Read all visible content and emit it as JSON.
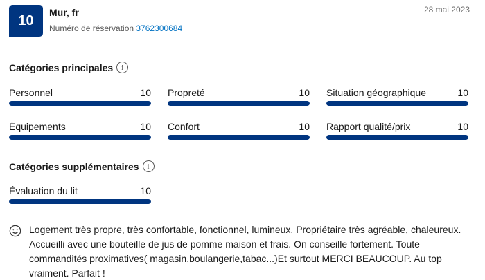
{
  "review": {
    "score": "10",
    "reviewer": "Mur, fr",
    "reservation_label": "Numéro de réservation",
    "reservation_number": "3762300684",
    "date": "28 mai 2023"
  },
  "main_categories": {
    "title": "Catégories principales",
    "items": [
      {
        "label": "Personnel",
        "score": "10",
        "fraction": 1.0
      },
      {
        "label": "Propreté",
        "score": "10",
        "fraction": 1.0
      },
      {
        "label": "Situation géographique",
        "score": "10",
        "fraction": 1.0
      },
      {
        "label": "Équipements",
        "score": "10",
        "fraction": 1.0
      },
      {
        "label": "Confort",
        "score": "10",
        "fraction": 1.0
      },
      {
        "label": "Rapport qualité/prix",
        "score": "10",
        "fraction": 1.0
      }
    ]
  },
  "extra_categories": {
    "title": "Catégories supplémentaires",
    "items": [
      {
        "label": "Évaluation du lit",
        "score": "10",
        "fraction": 1.0
      }
    ]
  },
  "comment": {
    "icon": "smile-icon",
    "text": "Logement très propre, très confortable, fonctionnel, lumineux. Propriétaire très agréable, chaleureux. Accueilli avec une bouteille de jus de pomme maison et frais. On conseille fortement. Toute commandités proximatives( magasin,boulangerie,tabac...)Et surtout MERCI BEAUCOUP. Au top vraiment. Parfait !"
  },
  "colors": {
    "brand": "#003580",
    "link": "#0071c2"
  }
}
